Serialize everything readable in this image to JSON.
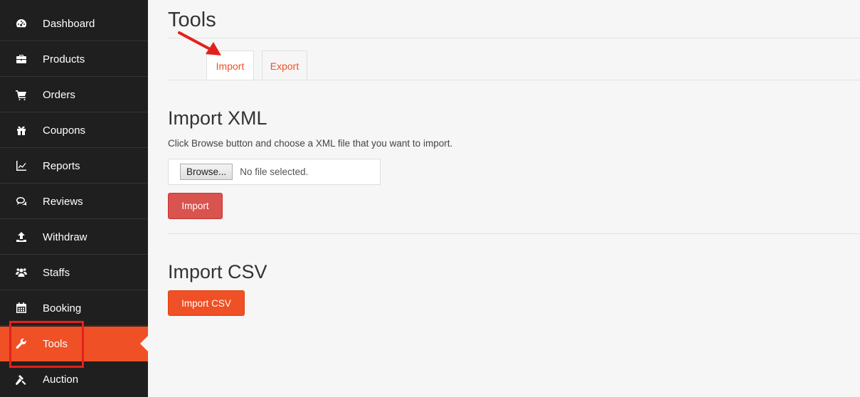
{
  "sidebar": {
    "items": [
      {
        "label": "Dashboard",
        "icon": "dashboard-icon"
      },
      {
        "label": "Products",
        "icon": "briefcase-icon"
      },
      {
        "label": "Orders",
        "icon": "cart-icon"
      },
      {
        "label": "Coupons",
        "icon": "gift-icon"
      },
      {
        "label": "Reports",
        "icon": "line-chart-icon"
      },
      {
        "label": "Reviews",
        "icon": "comments-icon"
      },
      {
        "label": "Withdraw",
        "icon": "upload-icon"
      },
      {
        "label": "Staffs",
        "icon": "users-icon"
      },
      {
        "label": "Booking",
        "icon": "calendar-icon"
      },
      {
        "label": "Tools",
        "icon": "wrench-icon",
        "active": true
      },
      {
        "label": "Auction",
        "icon": "gavel-icon"
      }
    ]
  },
  "main": {
    "title": "Tools",
    "tabs": [
      {
        "label": "Import",
        "active": true
      },
      {
        "label": "Export",
        "active": false
      }
    ],
    "import_xml": {
      "heading": "Import XML",
      "description": "Click Browse button and choose a XML file that you want to import.",
      "browse_label": "Browse...",
      "file_status": "No file selected.",
      "import_button": "Import"
    },
    "import_csv": {
      "heading": "Import CSV",
      "button": "Import CSV"
    }
  },
  "colors": {
    "accent": "#f05025",
    "sidebar_bg": "#1f1f1f",
    "import_button": "#d9534f",
    "annotation": "#e2211c"
  }
}
